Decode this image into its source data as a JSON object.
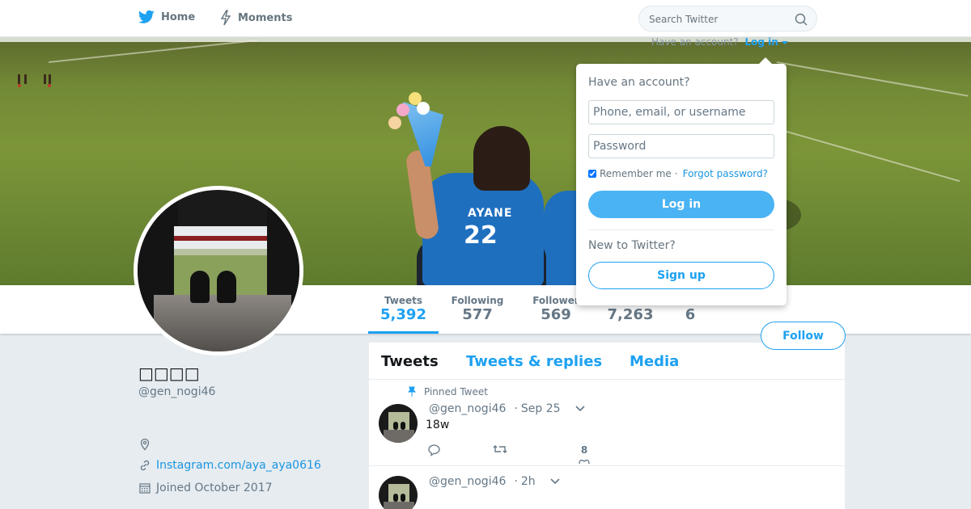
{
  "nav": {
    "home_label": "Home",
    "moments_label": "Moments",
    "search_placeholder": "Search Twitter"
  },
  "account_prompt": {
    "text": "Have an account?",
    "login_link": "Log in"
  },
  "login_box": {
    "title": "Have an account?",
    "username_placeholder": "Phone, email, or username",
    "password_placeholder": "Password",
    "remember_label": "Remember me",
    "separator": "·",
    "forgot_label": "Forgot password?",
    "login_button": "Log in",
    "new_label": "New to Twitter?",
    "signup_button": "Sign up"
  },
  "banner": {
    "jersey_name": "AYANE",
    "jersey_number": "22"
  },
  "stats": {
    "tweets": {
      "label": "Tweets",
      "value": "5,392"
    },
    "following": {
      "label": "Following",
      "value": "577"
    },
    "followers": {
      "label": "Follower",
      "value": "569"
    },
    "likes": {
      "value": "7,263"
    },
    "lists": {
      "value": "6"
    }
  },
  "follow_button": "Follow",
  "profile": {
    "name": "□□□□",
    "handle": "@gen_nogi46",
    "link": "Instagram.com/aya_aya0616",
    "joined": "Joined October 2017"
  },
  "timeline": {
    "tabs": [
      "Tweets",
      "Tweets & replies",
      "Media"
    ],
    "tweets": [
      {
        "pinned_label": "Pinned Tweet",
        "handle": "@gen_nogi46",
        "separator": "·",
        "time": "Sep 25",
        "text": "18w",
        "likes": "8"
      },
      {
        "handle": "@gen_nogi46",
        "separator": "·",
        "time": "2h"
      }
    ]
  },
  "colors": {
    "accent": "#1da1f2",
    "background": "#e6ecf0",
    "text_secondary": "#657786"
  }
}
